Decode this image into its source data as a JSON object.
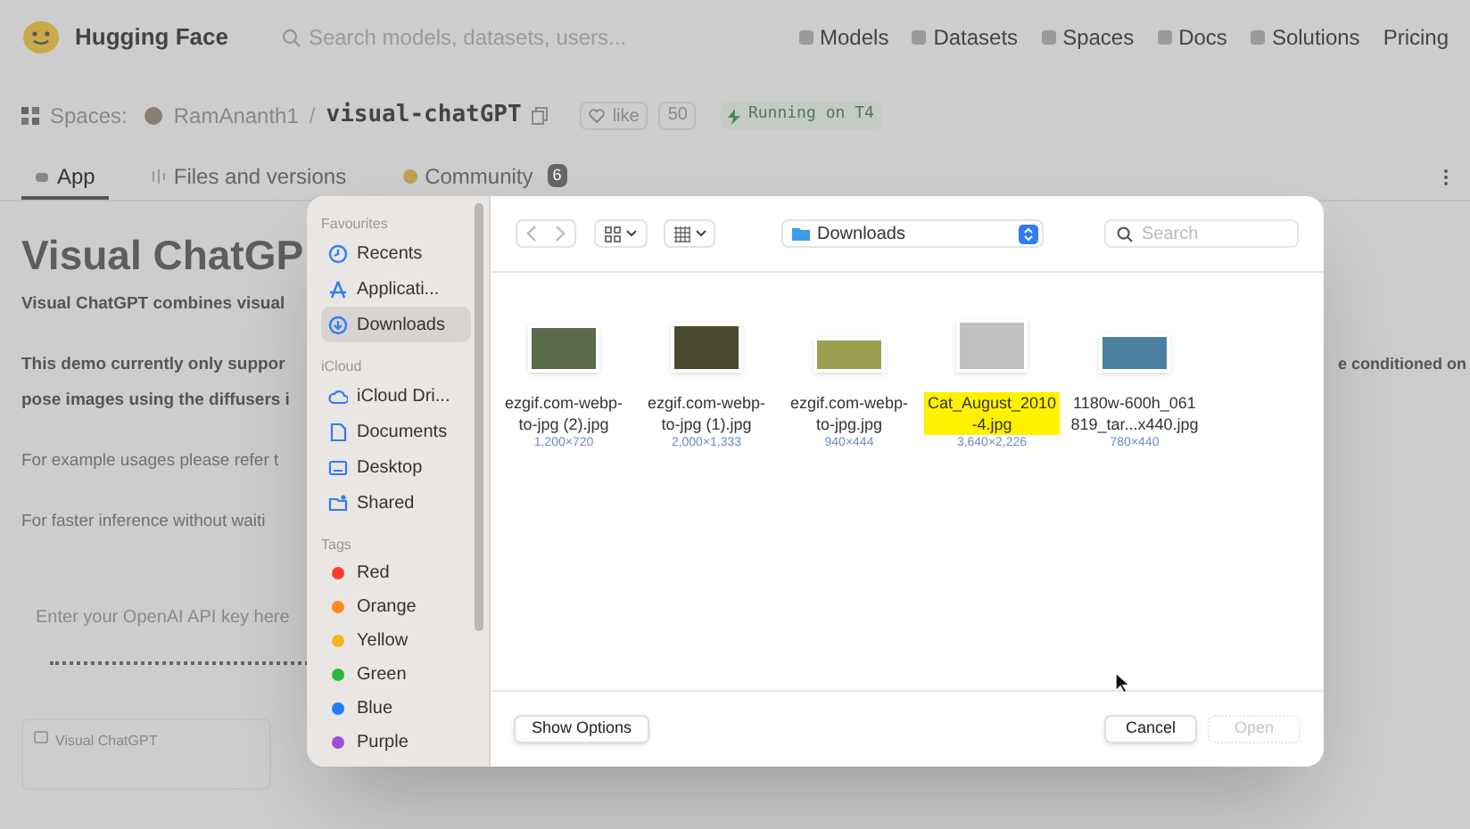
{
  "header": {
    "brand": "Hugging Face",
    "search": {
      "placeholder": "Search models, datasets, users..."
    },
    "nav": [
      "Models",
      "Datasets",
      "Spaces",
      "Docs",
      "Solutions",
      "Pricing"
    ]
  },
  "space": {
    "prefix": "Spaces:",
    "owner": "RamAnanth1",
    "separator": "/",
    "name": "visual-chatGPT",
    "like_label": "like",
    "like_count": "50",
    "status": "Running on T4"
  },
  "tabs": [
    {
      "label": "App",
      "selected": true
    },
    {
      "label": "Files and versions",
      "selected": false
    },
    {
      "label": "Community",
      "badge": "6",
      "selected": false
    }
  ],
  "app": {
    "title": "Visual ChatGP",
    "paragraphs": [
      {
        "kind": "bold",
        "lines": [
          "Visual ChatGPT combines visual"
        ]
      },
      {
        "kind": "bold",
        "lines": [
          "This demo currently only suppor",
          "pose images using the diffusers i"
        ],
        "right": "e conditioned on"
      },
      {
        "kind": "regular",
        "lines": [
          "For example usages please refer t"
        ]
      },
      {
        "kind": "regular",
        "lines": [
          "For faster inference without waiti"
        ]
      }
    ],
    "api_key": {
      "placeholder": "Enter your OpenAI API key here"
    },
    "chatbot_label": "Visual ChatGPT"
  },
  "dialog": {
    "sidebar": {
      "sections": [
        {
          "title": "Favourites",
          "items": [
            {
              "label": "Recents",
              "kind": "clock",
              "selected": false
            },
            {
              "label": "Applicati...",
              "kind": "apps",
              "selected": false
            },
            {
              "label": "Downloads",
              "kind": "download",
              "selected": true
            }
          ]
        },
        {
          "title": "iCloud",
          "items": [
            {
              "label": "iCloud Dri...",
              "kind": "cloud",
              "selected": false
            },
            {
              "label": "Documents",
              "kind": "document",
              "selected": false
            },
            {
              "label": "Desktop",
              "kind": "desktop",
              "selected": false
            },
            {
              "label": "Shared",
              "kind": "shared",
              "selected": false
            }
          ]
        }
      ],
      "tags": {
        "title": "Tags",
        "items": [
          {
            "label": "Red",
            "color": "#ff3b30"
          },
          {
            "label": "Orange",
            "color": "#ff8a1e"
          },
          {
            "label": "Yellow",
            "color": "#f5b31c"
          },
          {
            "label": "Green",
            "color": "#28b93a"
          },
          {
            "label": "Blue",
            "color": "#1f7bf6"
          },
          {
            "label": "Purple",
            "color": "#a24fd6"
          }
        ]
      }
    },
    "toolbar": {
      "location": "Downloads",
      "search": {
        "placeholder": "Search"
      }
    },
    "files": [
      {
        "name_lines": [
          "ezgif.com-webp-",
          "to-jpg (2).jpg"
        ],
        "dimensions": "1,200×720",
        "selected": false
      },
      {
        "name_lines": [
          "ezgif.com-webp-",
          "to-jpg (1).jpg"
        ],
        "dimensions": "2,000×1,333",
        "selected": false
      },
      {
        "name_lines": [
          "ezgif.com-webp-",
          "to-jpg.jpg"
        ],
        "dimensions": "940×444",
        "selected": false
      },
      {
        "name_lines": [
          "Cat_August_2010",
          "-4.jpg"
        ],
        "dimensions": "3,640×2,226",
        "selected": true
      },
      {
        "name_lines": [
          "1180w-600h_061",
          "819_tar...x440.jpg"
        ],
        "dimensions": "780×440",
        "selected": false
      }
    ],
    "buttons": {
      "options": "Show Options",
      "cancel": "Cancel",
      "open": {
        "label": "Open",
        "disabled": true
      }
    }
  }
}
